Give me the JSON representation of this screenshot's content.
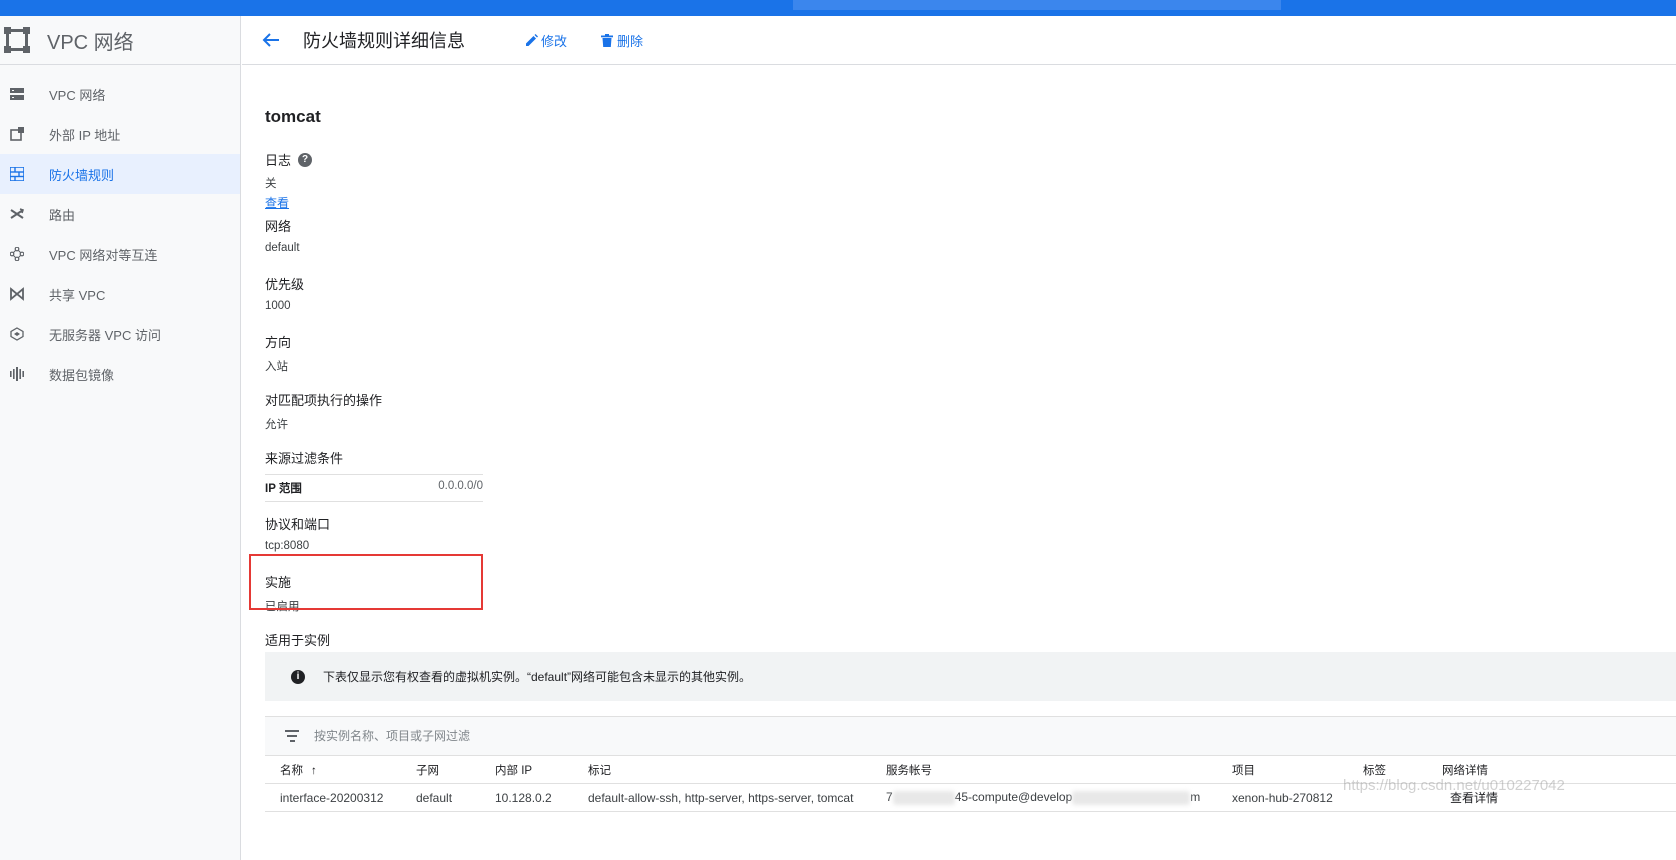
{
  "sidebar": {
    "title": "VPC 网络",
    "items": [
      {
        "label": "VPC 网络",
        "icon": "vpc-network-icon",
        "active": false
      },
      {
        "label": "外部 IP 地址",
        "icon": "external-ip-icon",
        "active": false
      },
      {
        "label": "防火墙规则",
        "icon": "firewall-icon",
        "active": true
      },
      {
        "label": "路由",
        "icon": "routes-icon",
        "active": false
      },
      {
        "label": "VPC 网络对等互连",
        "icon": "peering-icon",
        "active": false
      },
      {
        "label": "共享 VPC",
        "icon": "shared-vpc-icon",
        "active": false
      },
      {
        "label": "无服务器 VPC 访问",
        "icon": "serverless-icon",
        "active": false
      },
      {
        "label": "数据包镜像",
        "icon": "packet-mirroring-icon",
        "active": false
      }
    ]
  },
  "header": {
    "title": "防火墙规则详细信息",
    "edit_label": "修改",
    "delete_label": "删除"
  },
  "rule": {
    "name": "tomcat",
    "logs": {
      "label": "日志",
      "value": "关",
      "link": "查看"
    },
    "network": {
      "label": "网络",
      "value": "default"
    },
    "priority": {
      "label": "优先级",
      "value": "1000"
    },
    "direction": {
      "label": "方向",
      "value": "入站"
    },
    "action": {
      "label": "对匹配项执行的操作",
      "value": "允许"
    },
    "source_filter": {
      "label": "来源过滤条件",
      "key": "IP 范围",
      "value": "0.0.0.0/0"
    },
    "protocols": {
      "label": "协议和端口",
      "value": "tcp:8080"
    },
    "enforcement": {
      "label": "实施",
      "value": "已启用"
    },
    "applies_to": {
      "label": "适用于实例"
    }
  },
  "info_banner": "下表仅显示您有权查看的虚拟机实例。“default”网络可能包含未显示的其他实例。",
  "filter": {
    "placeholder": "按实例名称、项目或子网过滤"
  },
  "table": {
    "columns": [
      "名称",
      "子网",
      "内部 IP",
      "标记",
      "服务帐号",
      "项目",
      "标签",
      "网络详情"
    ],
    "rows": [
      {
        "name": "interface-20200312",
        "subnet": "default",
        "internal_ip": "10.128.0.2",
        "tags": "default-allow-ssh, http-server, https-server, tomcat",
        "service_account_prefix": "7",
        "service_account_mid": "45-compute@develop",
        "service_account_suffix": "m",
        "project": "xenon-hub-270812",
        "labels": "",
        "details_link": "查看详情"
      }
    ]
  },
  "watermark": "https://blog.csdn.net/u010227042",
  "colors": {
    "accent": "#1a73e8",
    "highlight": "#e53935",
    "sidebar_active_bg": "#e8f0fe"
  }
}
